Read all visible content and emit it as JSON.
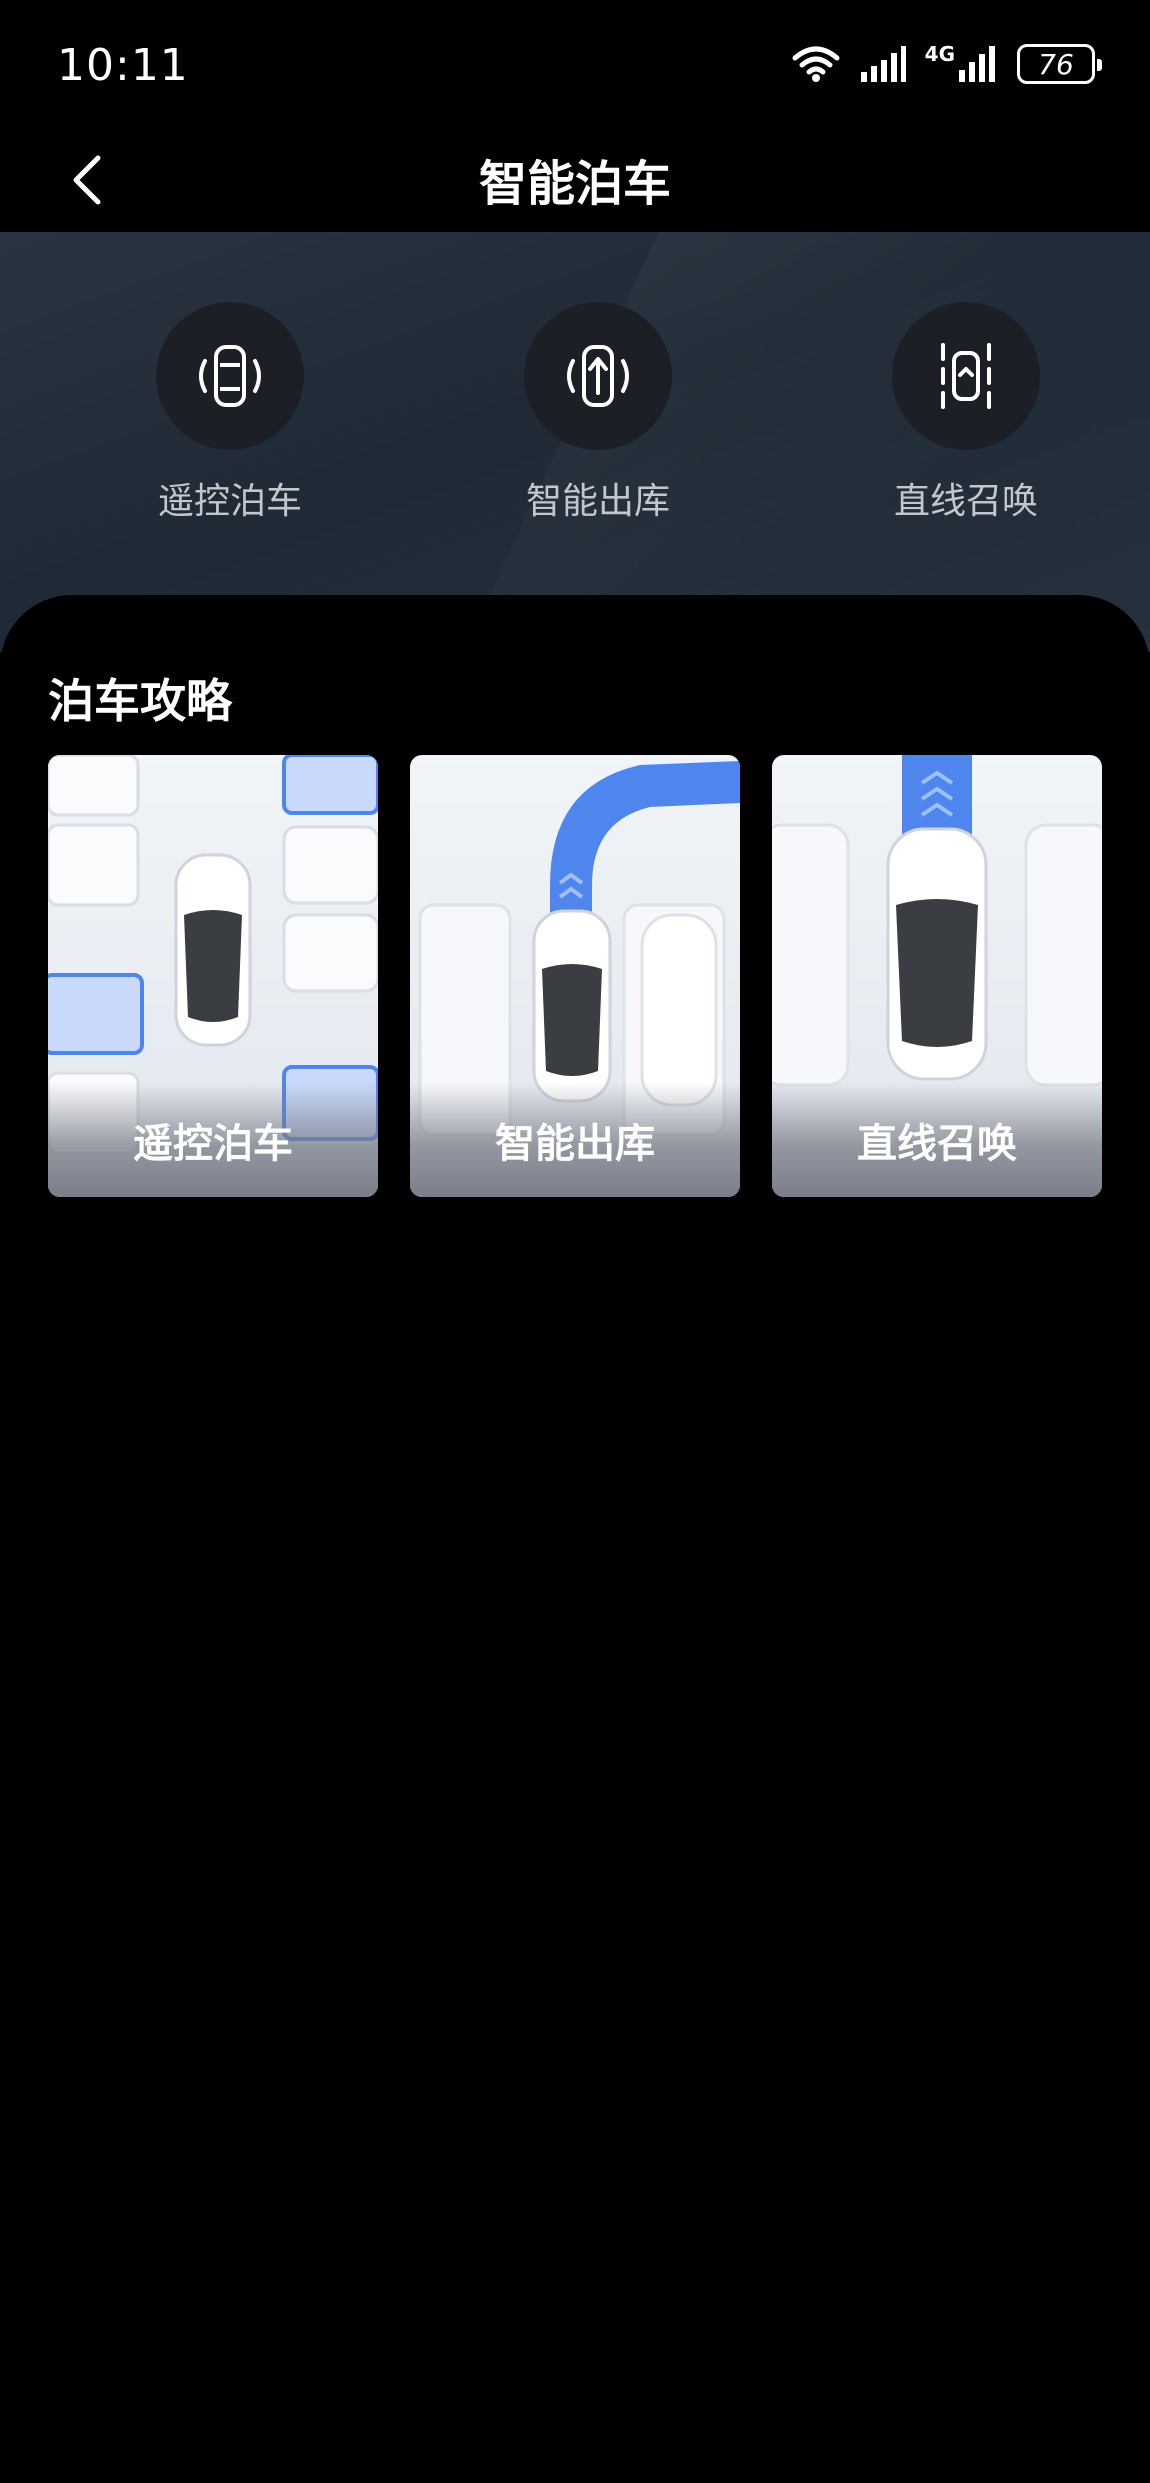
{
  "status_bar": {
    "time": "10:11",
    "network": "4G",
    "battery": "76"
  },
  "header": {
    "title": "智能泊车",
    "back_icon": "chevron-left-icon"
  },
  "modes": [
    {
      "label": "遥控泊车",
      "icon": "remote-parking-icon"
    },
    {
      "label": "智能出库",
      "icon": "smart-exit-icon"
    },
    {
      "label": "直线召唤",
      "icon": "straight-summon-icon"
    }
  ],
  "guide": {
    "title": "泊车攻略",
    "cards": [
      {
        "label": "遥控泊车"
      },
      {
        "label": "智能出库"
      },
      {
        "label": "直线召唤"
      }
    ]
  },
  "colors": {
    "accent_blue": "#4f86ee",
    "background": "#000000",
    "hero_background": "#25303c"
  }
}
